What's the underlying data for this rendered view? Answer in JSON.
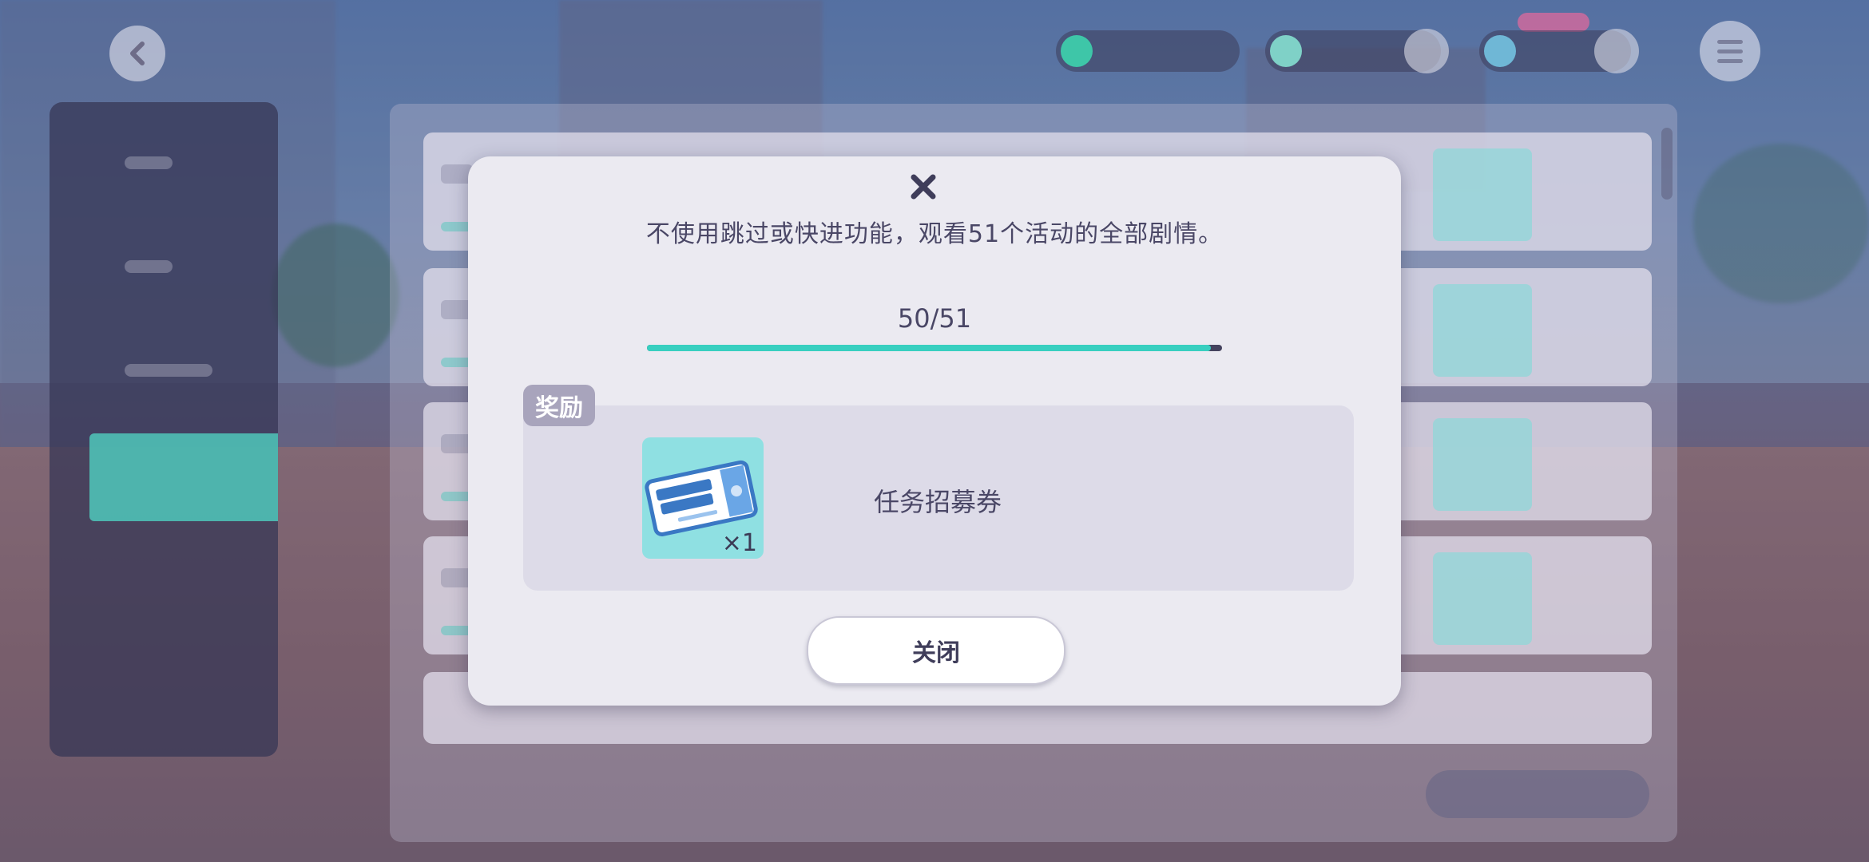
{
  "modal": {
    "description": "不使用跳过或快进功能，观看51个活动的全部剧情。",
    "progress": {
      "text": "50/51",
      "current": 50,
      "total": 51
    },
    "reward_label": "奖励",
    "reward_item": {
      "name": "任务招募券",
      "quantity": "×1",
      "icon": "gacha-ticket-icon"
    },
    "close_label": "关闭"
  },
  "colors": {
    "progress_fill": "#38cfc0",
    "progress_track": "#44425e",
    "modal_bg": "#ebeaf1",
    "reward_tile": "#8fe0e2",
    "side_active": "#4fc8bb"
  },
  "icons": {
    "back": "back-arrow-icon",
    "menu": "hamburger-menu-icon",
    "close": "close-icon"
  }
}
